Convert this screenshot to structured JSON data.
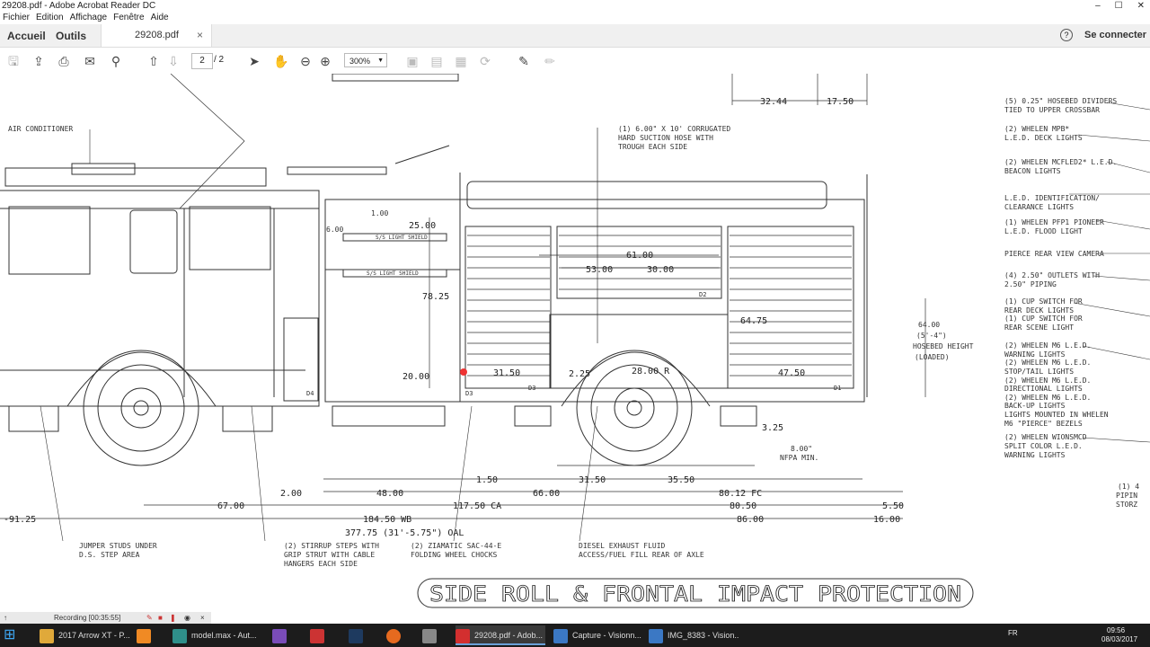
{
  "window": {
    "title": "29208.pdf - Adobe Acrobat Reader DC"
  },
  "menu": [
    "Fichier",
    "Edition",
    "Affichage",
    "Fenêtre",
    "Aide"
  ],
  "tabs": {
    "home": "Accueil",
    "tools": "Outils",
    "document": "29208.pdf",
    "sign_in": "Se connecter"
  },
  "toolbar": {
    "current_page": "2",
    "page_total": "/ 2",
    "zoom": "300%"
  },
  "drawing": {
    "title": "SIDE ROLL & FRONTAL IMPACT PROTECTION",
    "labels_left": [
      "AIR CONDITIONER"
    ],
    "labels_top": [
      "(1) 6.00\" X 10' CORRUGATED",
      "HARD SUCTION HOSE WITH",
      "TROUGH EACH SIDE"
    ],
    "labels_right": [
      "(5) 0.25\" HOSEBED DIVIDERS",
      "TIED TO UPPER CROSSBAR",
      "(2) WHELEN MPB*",
      "L.E.D. DECK LIGHTS",
      "(2) WHELEN MCFLED2* L.E.D.",
      "BEACON LIGHTS",
      "L.E.D. IDENTIFICATION/",
      "CLEARANCE LIGHTS",
      "(1) WHELEN PFP1 PIONEER",
      "L.E.D. FLOOD LIGHT",
      "PIERCE REAR VIEW CAMERA",
      "(4) 2.50\" OUTLETS WITH",
      "2.50\" PIPING",
      "(1) CUP SWITCH FOR",
      "REAR DECK LIGHTS",
      "(1) CUP SWITCH FOR",
      "REAR SCENE LIGHT",
      "(2) WHELEN M6 L.E.D.",
      "WARNING LIGHTS",
      "(2) WHELEN M6 L.E.D.",
      "STOP/TAIL LIGHTS",
      "(2) WHELEN M6 L.E.D.",
      "DIRECTIONAL LIGHTS",
      "(2) WHELEN M6 L.E.D.",
      "BACK-UP LIGHTS",
      "LIGHTS MOUNTED IN WHELEN",
      "M6 \"PIERCE\" BEZELS",
      "(2) WHELEN WIONSMCD",
      "SPLIT COLOR L.E.D.",
      "WARNING LIGHTS"
    ],
    "labels_far_right": [
      "(1) 4",
      "PIPIN",
      "STORZ"
    ],
    "labels_bottom": [
      "JUMPER STUDS UNDER",
      "D.S. STEP AREA",
      "(2) STIRRUP STEPS WITH",
      "GRIP STRUT WITH CABLE",
      "HANGERS EACH SIDE",
      "(2) ZIAMATIC SAC-44-E",
      "FOLDING WHEEL CHOCKS",
      "DIESEL EXHAUST FLUID",
      "ACCESS/FUEL FILL REAR OF AXLE"
    ],
    "hosebed": [
      "64.00",
      "(5'-4\")",
      "HOSEBED HEIGHT",
      "(LOADED)"
    ],
    "nfpa": [
      "8.00\"",
      "NFPA MIN."
    ],
    "shield_labels": [
      "S/S LIGHT SHIELD",
      "S/S LIGHT SHIELD"
    ],
    "dims": {
      "d3244": "32.44",
      "d1750": "17.50",
      "d2500": "25.00",
      "d100": "1.00",
      "d600": "6.00",
      "d7825": "78.25",
      "d2000": "20.00",
      "d6100": "61.00",
      "d5300": "53.00",
      "d3000": "30.00",
      "d6475": "64.75",
      "d3150a": "31.50",
      "d225": "2.25",
      "d2800": "28.00 R",
      "d4750": "47.50",
      "d325": "3.25",
      "d150": "1.50",
      "d3150b": "31.50",
      "d3550": "35.50",
      "d200": "2.00",
      "d4800": "48.00",
      "d6600": "66.00",
      "d8012": "80.12 FC",
      "d550": "5.50",
      "d6700": "67.00",
      "d11750": "117.50 CA",
      "d8050": "80.50",
      "d9125": "-91.25",
      "d18450": "184.50 WB",
      "d8600": "86.00",
      "d1600": "16.00",
      "d37775": "377.75 (31'-5.75\") OAL"
    },
    "tags": [
      "D4",
      "D3",
      "D1",
      "D2",
      "D3"
    ]
  },
  "recording": {
    "label": "Recording [00:35:55]"
  },
  "taskbar": {
    "items": [
      "2017 Arrow XT - P...",
      "model.max - Aut...",
      "29208.pdf - Adob...",
      "Capture - Visionn...",
      "IMG_8383 - Vision..."
    ],
    "lang": "FR",
    "time": "09:56",
    "date": "08/03/2017"
  }
}
